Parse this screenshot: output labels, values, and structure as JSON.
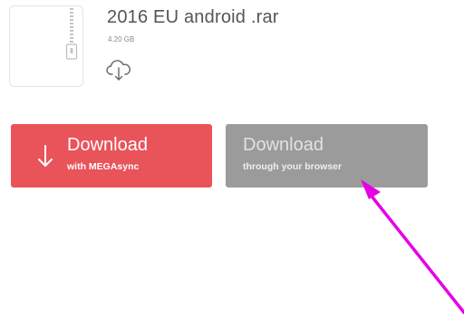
{
  "file": {
    "name": "2016 EU android .rar",
    "size": "4.20 GB",
    "type_icon": "zip-archive-icon",
    "action_icon": "cloud-download-icon"
  },
  "buttons": {
    "mega": {
      "title": "Download",
      "subtitle": "with MEGAsync",
      "icon": "down-arrow-icon",
      "color": "#e9535a"
    },
    "browser": {
      "title": "Download",
      "subtitle": "through your browser",
      "color": "#9b9b9b"
    }
  },
  "annotation": {
    "color": "#e600e6",
    "shape": "arrow"
  }
}
